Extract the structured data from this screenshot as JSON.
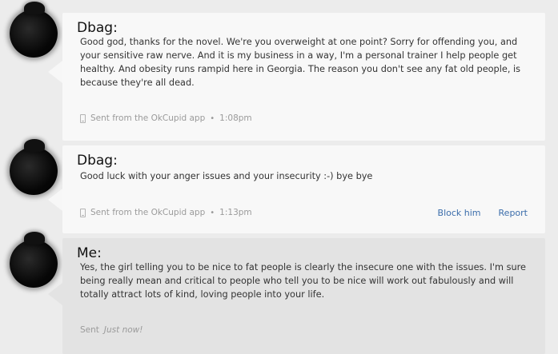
{
  "messages": [
    {
      "author": "Dbag:",
      "text": "Good god, thanks for the novel. We're you overweight at one point? Sorry for offending you, and your sensitive raw nerve. And it is my business in a way, I'm a personal trainer I help people get healthy. And obesity runs rampid here in Georgia. The reason you don't see any fat old people, is because they're all dead.",
      "sent_from": "Sent from the OkCupid app",
      "separator": "•",
      "time": "1:08pm"
    },
    {
      "author": "Dbag:",
      "text": "Good luck with your anger issues and your insecurity :-) bye bye",
      "sent_from": "Sent from the OkCupid app",
      "separator": "•",
      "time": "1:13pm",
      "actions": {
        "block": "Block him",
        "report": "Report"
      }
    },
    {
      "author": "Me:",
      "text": "Yes, the girl telling you to be nice to fat people is clearly the insecure one with the issues. I'm sure being really mean and critical to people who tell you to be nice will work out fabulously and will totally attract lots of kind, loving people into your life.",
      "sent_label": "Sent",
      "sent_time": "Just now!"
    }
  ],
  "icons": {
    "avatar": "avatar",
    "phone": "phone-icon"
  }
}
